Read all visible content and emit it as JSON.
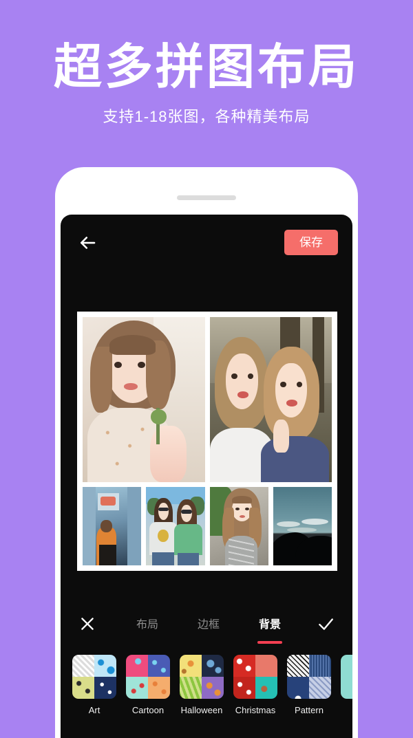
{
  "promo": {
    "title": "超多拼图布局",
    "subtitle": "支持1-18张图，各种精美布局",
    "bg_color": "#a882f2"
  },
  "app": {
    "topbar": {
      "back_icon": "back-arrow-icon",
      "save_label": "保存",
      "save_color": "#f56e6a"
    },
    "collage": {
      "background": "#ffffff",
      "layout": "2-top-4-bottom",
      "photos": [
        {
          "id": "photo-1",
          "position": "top-left",
          "desc": "woman selfie holding drink"
        },
        {
          "id": "photo-2",
          "position": "top-right",
          "desc": "two women outdoor selfie"
        },
        {
          "id": "photo-3",
          "position": "bottom-1",
          "desc": "person in orange jacket street"
        },
        {
          "id": "photo-4",
          "position": "bottom-2",
          "desc": "two women sunglasses street"
        },
        {
          "id": "photo-5",
          "position": "bottom-3",
          "desc": "woman grey top portrait"
        },
        {
          "id": "photo-6",
          "position": "bottom-4",
          "desc": "mountain silhouette sky"
        }
      ]
    },
    "toolbar": {
      "close_icon": "close-x-icon",
      "confirm_icon": "check-icon",
      "active_color": "#f43f52",
      "tabs": [
        {
          "label": "布局",
          "active": false
        },
        {
          "label": "边框",
          "active": false
        },
        {
          "label": "背景",
          "active": true
        }
      ]
    },
    "backgrounds": [
      {
        "label": "Art",
        "colors": [
          "#dcdcdc",
          "#bfe6f7",
          "#d9dd8a",
          "#1d3263"
        ]
      },
      {
        "label": "Cartoon",
        "colors": [
          "#ef4c7e",
          "#4a5bb5",
          "#9fe4d8",
          "#f5ad6d"
        ]
      },
      {
        "label": "Halloween",
        "colors": [
          "#f2e07a",
          "#1f2a44",
          "#8dc63f",
          "#8e6bc4"
        ]
      },
      {
        "label": "Christmas",
        "colors": [
          "#d62b24",
          "#e8796a",
          "#c2241d",
          "#25c0b4"
        ]
      },
      {
        "label": "Pattern",
        "colors": [
          "#f2f2f2",
          "#2b4a7d",
          "#27427a",
          "#c6cfe6"
        ]
      },
      {
        "label": "",
        "colors": [
          "#8fdcd2",
          "#e8dcc6",
          "#8fdcd2",
          "#e8dcc6"
        ]
      }
    ]
  }
}
